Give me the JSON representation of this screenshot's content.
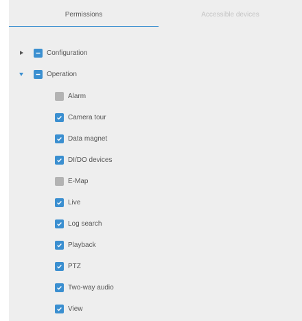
{
  "tabs": {
    "permissions": "Permissions",
    "accessible_devices": "Accessible devices"
  },
  "tree": {
    "configuration": {
      "label": "Configuration",
      "expanded": false,
      "state": "partial"
    },
    "operation": {
      "label": "Operation",
      "expanded": true,
      "state": "partial"
    },
    "operation_children": [
      {
        "label": "Alarm",
        "checked": false
      },
      {
        "label": "Camera tour",
        "checked": true
      },
      {
        "label": "Data magnet",
        "checked": true
      },
      {
        "label": "DI/DO devices",
        "checked": true
      },
      {
        "label": "E-Map",
        "checked": false
      },
      {
        "label": "Live",
        "checked": true
      },
      {
        "label": "Log search",
        "checked": true
      },
      {
        "label": "Playback",
        "checked": true
      },
      {
        "label": "PTZ",
        "checked": true
      },
      {
        "label": "Two-way audio",
        "checked": true
      },
      {
        "label": "View",
        "checked": true
      }
    ]
  },
  "colors": {
    "accent": "#3b8fd0",
    "unchecked": "#b3b3b3",
    "background": "#eeeeee"
  },
  "icons": {
    "collapsed": "caret-right-icon",
    "expanded": "caret-down-icon",
    "partial": "dash-icon",
    "checked": "checkmark-icon"
  }
}
